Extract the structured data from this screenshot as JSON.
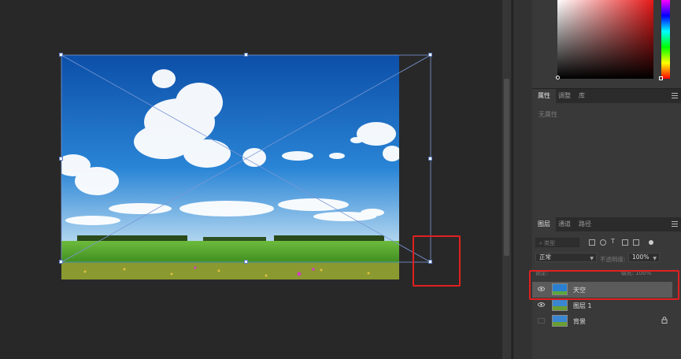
{
  "properties_panel": {
    "tabs": [
      {
        "label": "属性",
        "active": true
      },
      {
        "label": "调整",
        "active": false
      },
      {
        "label": "库",
        "active": false
      }
    ],
    "empty_text": "无属性"
  },
  "layers_panel": {
    "tabs": [
      {
        "label": "图层",
        "active": true
      },
      {
        "label": "通道",
        "active": false
      },
      {
        "label": "路径",
        "active": false
      }
    ],
    "filter_placeholder": "类型",
    "blend_mode": "正常",
    "opacity_label": "不透明度:",
    "opacity_value": "100%",
    "lock_label": "锁定:",
    "fill_label": "填充:",
    "fill_value": "100%",
    "layers": [
      {
        "name": "天空",
        "visible": true,
        "selected": true,
        "locked": false
      },
      {
        "name": "图层 1",
        "visible": true,
        "selected": false,
        "locked": false
      },
      {
        "name": "背景",
        "visible": false,
        "selected": false,
        "locked": true
      }
    ]
  },
  "colors": {
    "highlight": "#e02020",
    "transform_line": "#6f8fd4",
    "selected_layer": "#5b5b5b",
    "sky": "#1e6fc2",
    "grass": "#4f9a2a"
  },
  "icons": {
    "visibility": "eye-icon",
    "lock": "lock-icon",
    "menu": "panel-menu-icon"
  }
}
